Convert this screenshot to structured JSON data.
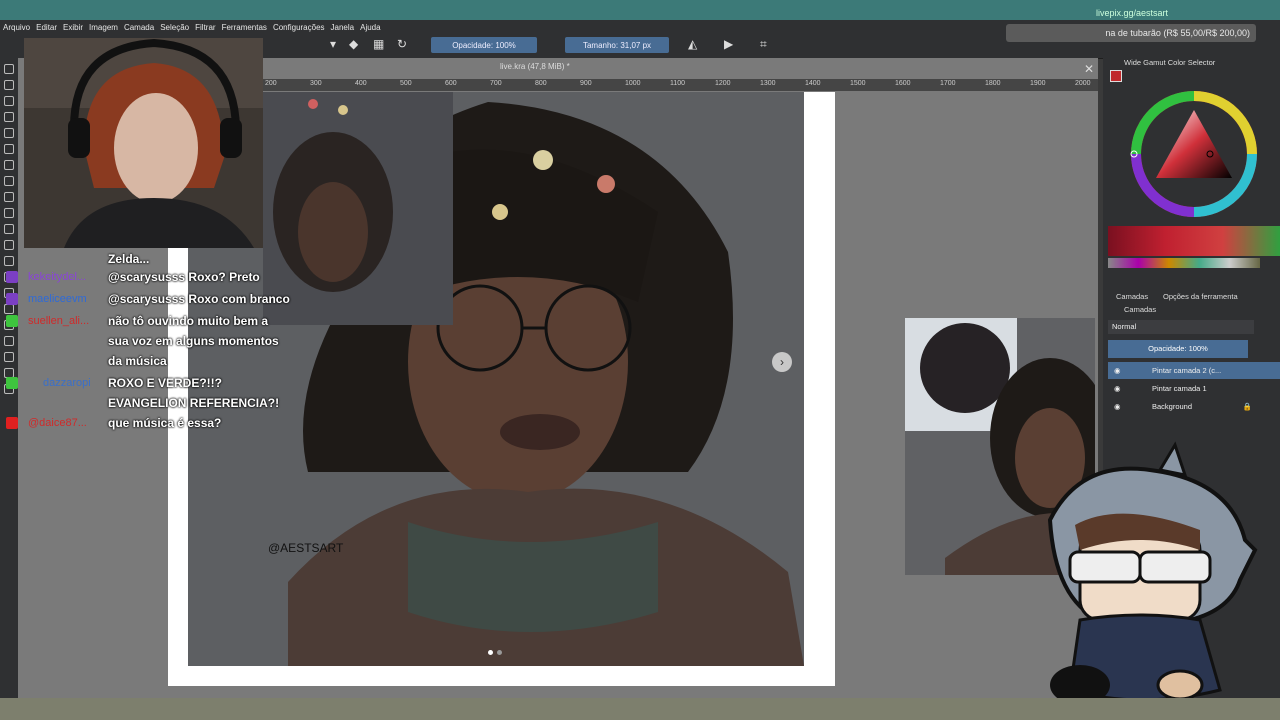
{
  "menu": [
    "Arquivo",
    "Editar",
    "Exibir",
    "Imagem",
    "Camada",
    "Seleção",
    "Filtrar",
    "Ferramentas",
    "Configurações",
    "Janela",
    "Ajuda"
  ],
  "toolbar": {
    "opacity_label": "Opacidade: 100%",
    "size_label": "Tamanho: 31,07 px"
  },
  "overlay": {
    "url": "livepix.gg/aestsart",
    "goal": "na de tubarão (R$ 55,00/R$ 200,00)"
  },
  "document": {
    "title": "live.kra (47,8 MiB) *",
    "ruler_ticks": [
      "200",
      "300",
      "400",
      "500",
      "600",
      "700",
      "800",
      "900",
      "1000",
      "1100",
      "1200",
      "1300",
      "1400",
      "1500",
      "1600",
      "1700",
      "1800",
      "1900",
      "2000"
    ],
    "signature": "@AESTSART"
  },
  "chat": [
    {
      "user": "",
      "message": "Zelda...",
      "user_color": "#a06ad0",
      "badge": ""
    },
    {
      "user": "kekeitydel...",
      "message": "@scarysusss Roxo? Preto",
      "user_color": "#8a44d8",
      "badge": "#7b3fc4"
    },
    {
      "user": "maeliceevm",
      "message": "@scarysusss Roxo com branco",
      "user_color": "#2e6ad8",
      "badge": "#7b3fc4"
    },
    {
      "user": "suellen_ali...",
      "message": "não tô ouvindo muito bem a",
      "user_color": "#d02a2a",
      "badge": "#3ec43e"
    },
    {
      "user": "",
      "message": "sua voz em alguns momentos",
      "user_color": "#d02a2a",
      "badge": ""
    },
    {
      "user": "",
      "message": "da música",
      "user_color": "#d02a2a",
      "badge": ""
    },
    {
      "user": "dazzaropi",
      "message": "ROXO E VERDE?!!?",
      "user_color": "#3a6fc9",
      "badge": "#3ec43e"
    },
    {
      "user": "",
      "message": "EVANGELION REFERENCIA?!",
      "user_color": "#3a6fc9",
      "badge": ""
    },
    {
      "user": "@daice87...",
      "message": "que música é essa?",
      "user_color": "#d02a2a",
      "badge": "#e02020"
    }
  ],
  "dock": {
    "color_selector_title": "Wide Gamut Color Selector",
    "tabs": [
      "Camadas",
      "Opções da ferramenta"
    ],
    "layers_title": "Camadas",
    "blend_mode": "Normal",
    "layer_opacity": "Opacidade: 100%",
    "layers": [
      {
        "name": "Pintar camada 2 (c...",
        "active": true
      },
      {
        "name": "Pintar camada 1",
        "active": false
      },
      {
        "name": "Background",
        "active": false
      }
    ]
  },
  "colors": {
    "accent": "#486c94",
    "panel": "#2f3032",
    "canvas_bg": "#7a7a7a"
  }
}
